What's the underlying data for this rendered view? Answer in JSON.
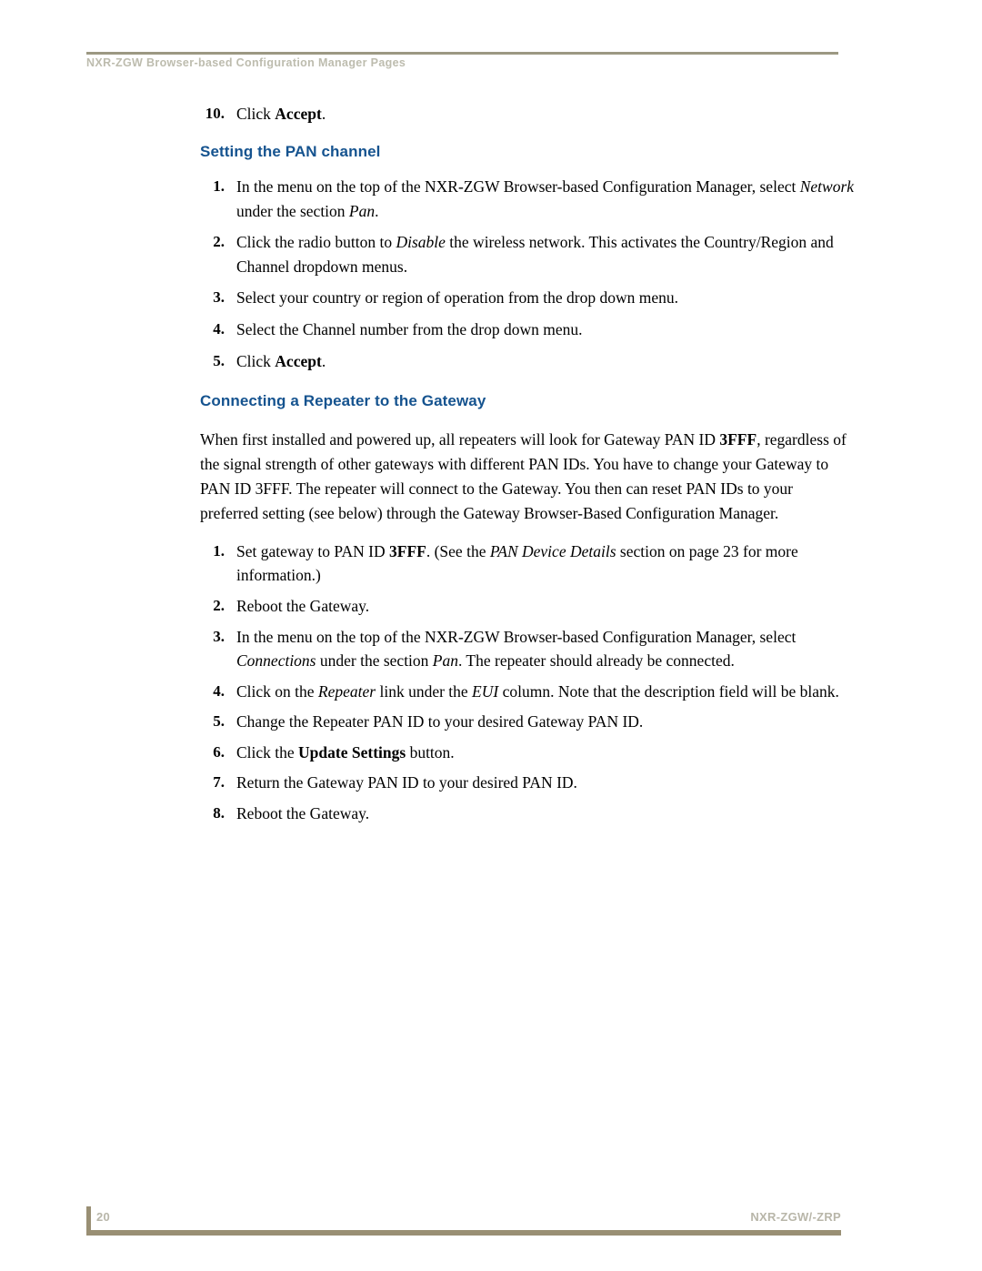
{
  "header": {
    "running_title": "NXR-ZGW Browser-based Configuration Manager Pages"
  },
  "footer": {
    "page_number": "20",
    "document_id": "NXR-ZGW/-ZRP"
  },
  "colors": {
    "heading_blue": "#15538f",
    "rule_tan": "#998f74",
    "header_rule_tan": "#9c9882",
    "muted_text": "#b8b6a9",
    "body_text": "#000000"
  },
  "content": {
    "lead_step": {
      "number": "10.",
      "text_before": "Click ",
      "bold": "Accept",
      "text_after": "."
    },
    "heading_1": "Setting the PAN channel",
    "list_1": [
      {
        "number": "1.",
        "parts": [
          {
            "t": "In the menu on the top of the NXR-ZGW Browser-based Configuration Manager, select ",
            "s": "normal"
          },
          {
            "t": "Network",
            "s": "italic"
          },
          {
            "t": " under the section ",
            "s": "normal"
          },
          {
            "t": "Pan",
            "s": "italic"
          },
          {
            "t": ".",
            "s": "normal"
          }
        ]
      },
      {
        "number": "2.",
        "parts": [
          {
            "t": "Click the radio button to ",
            "s": "normal"
          },
          {
            "t": "Disable",
            "s": "italic"
          },
          {
            "t": " the wireless network. This activates the Country/Region and Channel dropdown menus.",
            "s": "normal"
          }
        ]
      },
      {
        "number": "3.",
        "parts": [
          {
            "t": "Select your country or region of operation from the drop down menu.",
            "s": "normal"
          }
        ]
      },
      {
        "number": "4.",
        "parts": [
          {
            "t": "Select the Channel number from the drop down menu.",
            "s": "normal"
          }
        ]
      },
      {
        "number": "5.",
        "parts": [
          {
            "t": "Click ",
            "s": "normal"
          },
          {
            "t": "Accept",
            "s": "bold"
          },
          {
            "t": ".",
            "s": "normal"
          }
        ]
      }
    ],
    "heading_2": "Connecting a Repeater to the Gateway",
    "paragraph": [
      {
        "t": "When first installed and powered up, all repeaters will look for Gateway PAN ID ",
        "s": "normal"
      },
      {
        "t": "3FFF",
        "s": "bold"
      },
      {
        "t": ", regardless of the signal strength of other gateways with different PAN IDs. You have to change your Gateway to PAN ID 3FFF. The repeater will connect to the Gateway. You then can reset PAN IDs to your preferred setting (see below) through the Gateway Browser-Based Configuration Manager.",
        "s": "normal"
      }
    ],
    "list_2": [
      {
        "number": "1.",
        "parts": [
          {
            "t": "Set gateway to PAN ID ",
            "s": "normal"
          },
          {
            "t": "3FFF",
            "s": "bold"
          },
          {
            "t": ". (See the ",
            "s": "normal"
          },
          {
            "t": "PAN Device Details",
            "s": "italic"
          },
          {
            "t": " section on page 23 for more information.)",
            "s": "normal"
          }
        ]
      },
      {
        "number": "2.",
        "parts": [
          {
            "t": "Reboot the Gateway.",
            "s": "normal"
          }
        ]
      },
      {
        "number": "3.",
        "parts": [
          {
            "t": "In the menu on the top of the NXR-ZGW Browser-based Configuration Manager, select ",
            "s": "normal"
          },
          {
            "t": "Connections",
            "s": "italic"
          },
          {
            "t": " under the section ",
            "s": "normal"
          },
          {
            "t": "Pan",
            "s": "italic"
          },
          {
            "t": ". The repeater should already be connected.",
            "s": "normal"
          }
        ]
      },
      {
        "number": "4.",
        "parts": [
          {
            "t": "Click on the ",
            "s": "normal"
          },
          {
            "t": "Repeater",
            "s": "italic"
          },
          {
            "t": " link under the ",
            "s": "normal"
          },
          {
            "t": "EUI",
            "s": "italic"
          },
          {
            "t": " column. Note that the description field will be blank.",
            "s": "normal"
          }
        ]
      },
      {
        "number": "5.",
        "parts": [
          {
            "t": "Change the Repeater PAN ID to your desired Gateway PAN ID.",
            "s": "normal"
          }
        ]
      },
      {
        "number": "6.",
        "emphasized": true,
        "parts": [
          {
            "t": "Click the ",
            "s": "normal"
          },
          {
            "t": "Update Settings",
            "s": "bold"
          },
          {
            "t": " button.",
            "s": "normal"
          }
        ]
      },
      {
        "number": "7.",
        "parts": [
          {
            "t": "Return the Gateway PAN ID to your desired PAN ID.",
            "s": "normal"
          }
        ]
      },
      {
        "number": "8.",
        "parts": [
          {
            "t": "Reboot the Gateway.",
            "s": "normal"
          }
        ]
      }
    ]
  }
}
